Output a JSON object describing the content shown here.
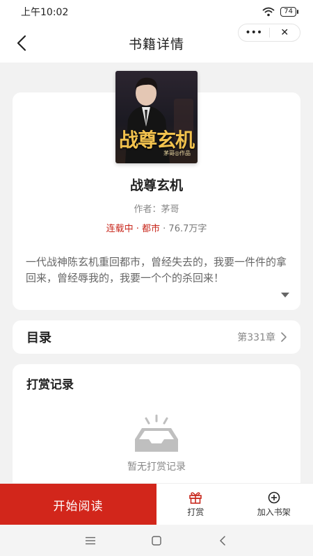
{
  "status_bar": {
    "time": "上午10:02",
    "battery": "74"
  },
  "nav": {
    "title": "书籍详情",
    "more_icon": "•••",
    "close_icon": "✕"
  },
  "book": {
    "cover_title": "战尊玄机",
    "cover_subtitle": "茅哥◎作品",
    "title": "战尊玄机",
    "author": "作者：茅哥",
    "status_genre": "连载中 · 都市",
    "word_count": " · 76.7万字",
    "description": "一代战神陈玄机重回都市，曾经失去的，我要一件件的拿回来，曾经辱我的，我要一个个的杀回来！"
  },
  "catalog": {
    "label": "目录",
    "chapter": "第331章"
  },
  "reward": {
    "title": "打赏记录",
    "empty_text": "暂无打赏记录"
  },
  "bottom_bar": {
    "start_read": "开始阅读",
    "reward": "打赏",
    "add_shelf": "加入书架"
  },
  "colors": {
    "accent": "#d2261b",
    "status_red": "#c8281d"
  }
}
